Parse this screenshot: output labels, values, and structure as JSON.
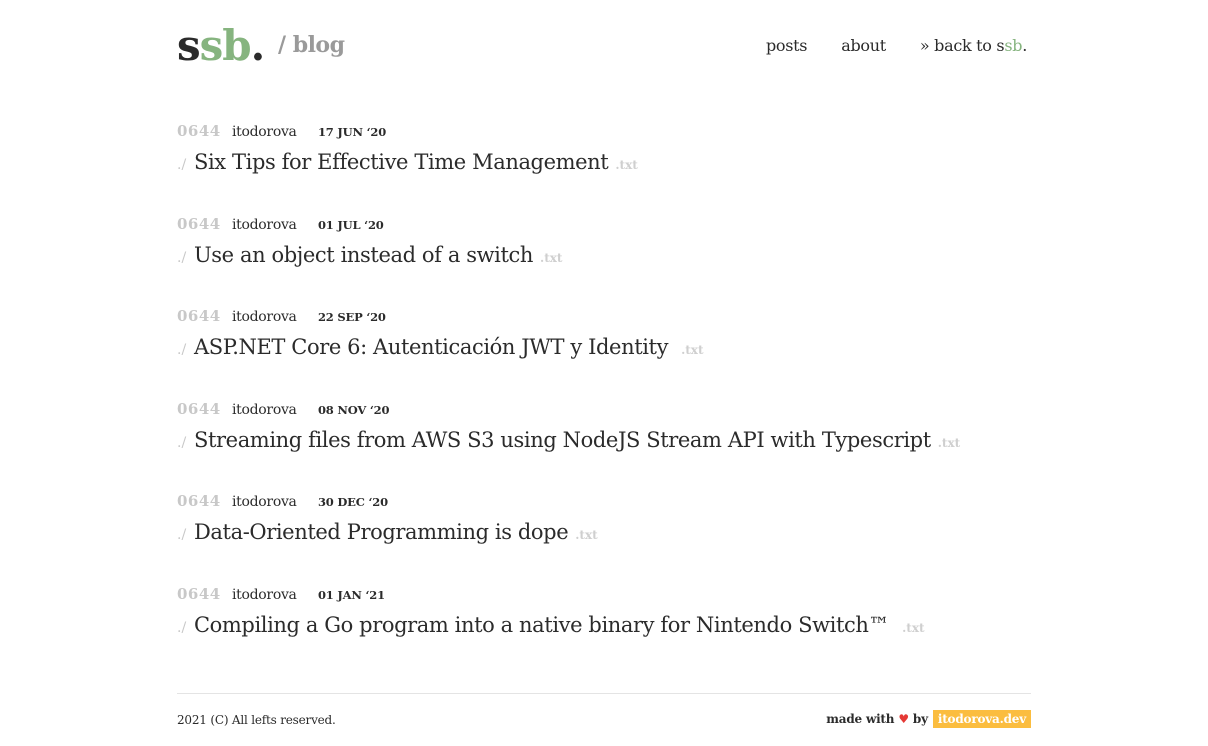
{
  "header": {
    "logo": {
      "part1": "s",
      "part2": "sb",
      "part3": "."
    },
    "subtitle": "/ blog",
    "nav": {
      "posts": "posts",
      "about": "about",
      "back_prefix": "» back to s",
      "back_green": "sb",
      "back_suffix": "."
    }
  },
  "posts": [
    {
      "perm": "0644",
      "author": "itodorova",
      "date": "17 JUN ‘20",
      "prefix": "./",
      "title": "Six Tips for Effective Time Management",
      "ext": ".txt"
    },
    {
      "perm": "0644",
      "author": "itodorova",
      "date": "01 JUL ‘20",
      "prefix": "./",
      "title": "Use an object instead of a switch",
      "ext": ".txt"
    },
    {
      "perm": "0644",
      "author": "itodorova",
      "date": "22 SEP ‘20",
      "prefix": "./",
      "title": "ASP.NET Core 6: Autenticación JWT y Identity",
      "ext": ".txt"
    },
    {
      "perm": "0644",
      "author": "itodorova",
      "date": "08 NOV ‘20",
      "prefix": "./",
      "title": "Streaming files from AWS S3 using NodeJS Stream API with Typescript",
      "ext": ".txt"
    },
    {
      "perm": "0644",
      "author": "itodorova",
      "date": "30 DEC ‘20",
      "prefix": "./",
      "title": "Data-Oriented Programming is dope",
      "ext": ".txt"
    },
    {
      "perm": "0644",
      "author": "itodorova",
      "date": "01 JAN ‘21",
      "prefix": "./",
      "title": "Compiling a Go program into a native binary for Nintendo Switch™",
      "ext": ".txt"
    }
  ],
  "footer": {
    "copyright": "2021 (C) All lefts reserved.",
    "made_with": "made with",
    "heart": "♥",
    "by": "by",
    "site": "itodorova.dev"
  },
  "colors": {
    "accent_green": "#86b47f",
    "badge_yellow": "#fbbd3f",
    "text": "#2b2b2b",
    "muted": "#c8c8c8"
  }
}
